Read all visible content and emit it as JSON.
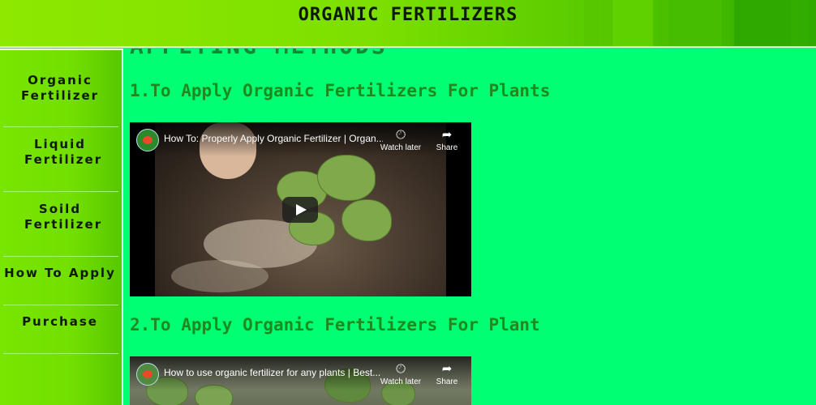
{
  "header": {
    "title": "ORGANIC FERTILIZERS"
  },
  "sidebar": {
    "items": [
      {
        "label": "Organic Fertilizer"
      },
      {
        "label": "Liquid Fertilizer"
      },
      {
        "label": "Soild Fertilizer"
      },
      {
        "label": "How To Apply"
      },
      {
        "label": "Purchase"
      }
    ]
  },
  "main": {
    "page_title": "APPLYING METHODS",
    "sections": [
      {
        "heading": "1.To Apply Organic Fertilizers For Plants",
        "video": {
          "title": "How To: Properly Apply Organic Fertilizer | Organ...",
          "watch_later": "Watch later",
          "share": "Share"
        }
      },
      {
        "heading": "2.To Apply Organic Fertilizers For Plant",
        "video": {
          "title": "How to use organic fertilizer for any plants | Best...",
          "watch_later": "Watch later",
          "share": "Share"
        }
      }
    ]
  },
  "colors": {
    "page_background": "#00ff73",
    "header_start": "#8ee800",
    "header_end": "#2faa00",
    "heading_text": "#1e8a1e"
  }
}
